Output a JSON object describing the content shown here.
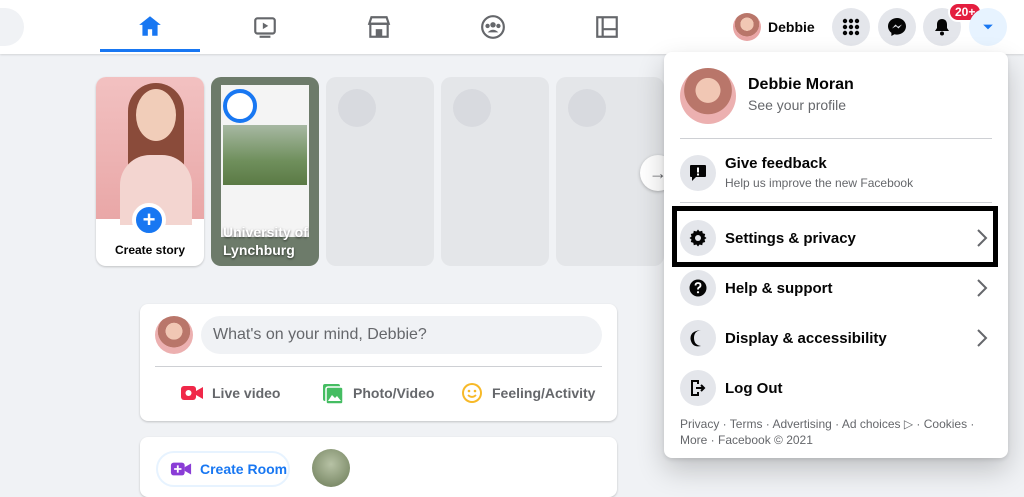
{
  "topbar": {
    "profile_name": "Debbie",
    "notifications_badge": "20+",
    "tabs": [
      "home-icon",
      "watch-icon",
      "marketplace-icon",
      "groups-icon",
      "gaming-icon"
    ]
  },
  "stories": {
    "create_label": "Create story",
    "university_label": "University of Lynchburg"
  },
  "composer": {
    "placeholder": "What's on your mind, Debbie?",
    "live_video": "Live video",
    "photo_video": "Photo/Video",
    "feeling": "Feeling/Activity"
  },
  "rooms": {
    "create_room": "Create Room"
  },
  "menu": {
    "name": "Debbie Moran",
    "see_profile": "See your profile",
    "give_feedback": "Give feedback",
    "give_feedback_sub": "Help us improve the new Facebook",
    "settings": "Settings & privacy",
    "help": "Help & support",
    "display": "Display & accessibility",
    "logout": "Log Out",
    "footer": "Privacy · Terms · Advertising · Ad choices ▷ · Cookies · More · Facebook © 2021"
  },
  "colors": {
    "accent": "#1877f2",
    "badge": "#e41e3f"
  }
}
